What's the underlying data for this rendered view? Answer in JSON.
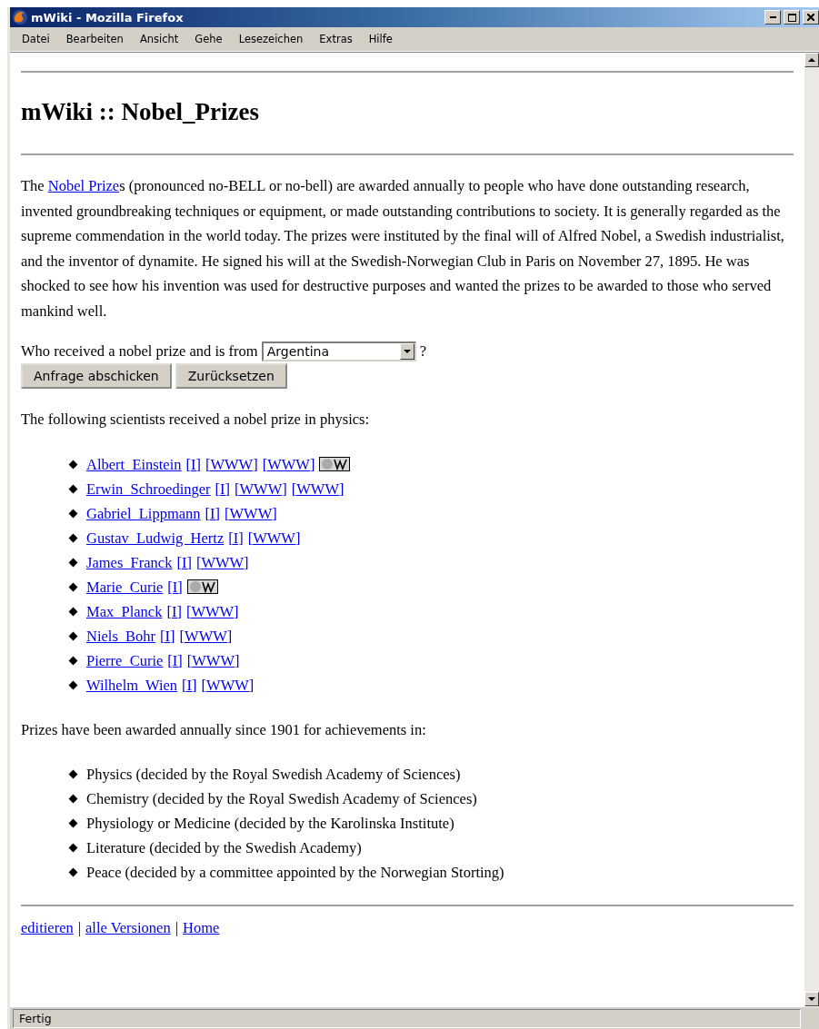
{
  "window": {
    "title": "mWiki - Mozilla Firefox"
  },
  "menu": [
    "Datei",
    "Bearbeiten",
    "Ansicht",
    "Gehe",
    "Lesezeichen",
    "Extras",
    "Hilfe"
  ],
  "page": {
    "heading": "mWiki :: Nobel_Prizes",
    "intro": {
      "before": "The ",
      "link": "Nobel Prize",
      "after": "s (pronounced no-BELL or no-bell) are awarded annually to people who have done outstanding research, invented groundbreaking techniques or equipment, or made outstanding contributions to society. It is generally regarded as the supreme commendation in the world today. The prizes were instituted by the final will of Alfred Nobel, a Swedish industrialist, and the inventor of dynamite. He signed his will at the Swedish-Norwegian Club in Paris on November 27, 1895. He was shocked to see how his invention was used for destructive purposes and wanted the prizes to be awarded to those who served mankind well."
    },
    "query": {
      "label": "Who received a nobel prize and is from",
      "value": "Argentina",
      "suffix": "?",
      "buttons": [
        "Anfrage abschicken",
        "Zurücksetzen"
      ]
    },
    "results_intro": "The following scientists received a nobel prize in physics:",
    "scientists": [
      {
        "name": "Albert  Einstein",
        "links": [
          "[I]",
          "[WWW]",
          "[WWW]"
        ],
        "wikipedia": true
      },
      {
        "name": "Erwin  Schroedinger",
        "links": [
          "[I]",
          "[WWW]",
          "[WWW]"
        ],
        "wikipedia": false
      },
      {
        "name": "Gabriel  Lippmann",
        "links": [
          "[I]",
          "[WWW]"
        ],
        "wikipedia": false
      },
      {
        "name": "Gustav  Ludwig  Hertz",
        "links": [
          "[I]",
          "[WWW]"
        ],
        "wikipedia": false
      },
      {
        "name": "James  Franck",
        "links": [
          "[I]",
          "[WWW]"
        ],
        "wikipedia": false
      },
      {
        "name": "Marie  Curie",
        "links": [
          "[I]"
        ],
        "wikipedia": true
      },
      {
        "name": "Max  Planck",
        "links": [
          "[I]",
          "[WWW]"
        ],
        "wikipedia": false
      },
      {
        "name": "Niels  Bohr",
        "links": [
          "[I]",
          "[WWW]"
        ],
        "wikipedia": false
      },
      {
        "name": "Pierre  Curie",
        "links": [
          "[I]",
          "[WWW]"
        ],
        "wikipedia": false
      },
      {
        "name": "Wilhelm  Wien",
        "links": [
          "[I]",
          "[WWW]"
        ],
        "wikipedia": false
      }
    ],
    "categories_intro": "Prizes have been awarded annually since 1901 for achievements in:",
    "categories": [
      "Physics (decided by the Royal Swedish Academy of Sciences)",
      "Chemistry (decided by the Royal Swedish Academy of Sciences)",
      "Physiology or Medicine (decided by the Karolinska Institute)",
      "Literature (decided by the Swedish Academy)",
      "Peace (decided by a committee appointed by the Norwegian Storting)"
    ],
    "footer": {
      "links": [
        "editieren",
        "alle Versionen",
        "Home"
      ],
      "separator": "|"
    }
  },
  "status_bar": {
    "text": "Fertig"
  }
}
